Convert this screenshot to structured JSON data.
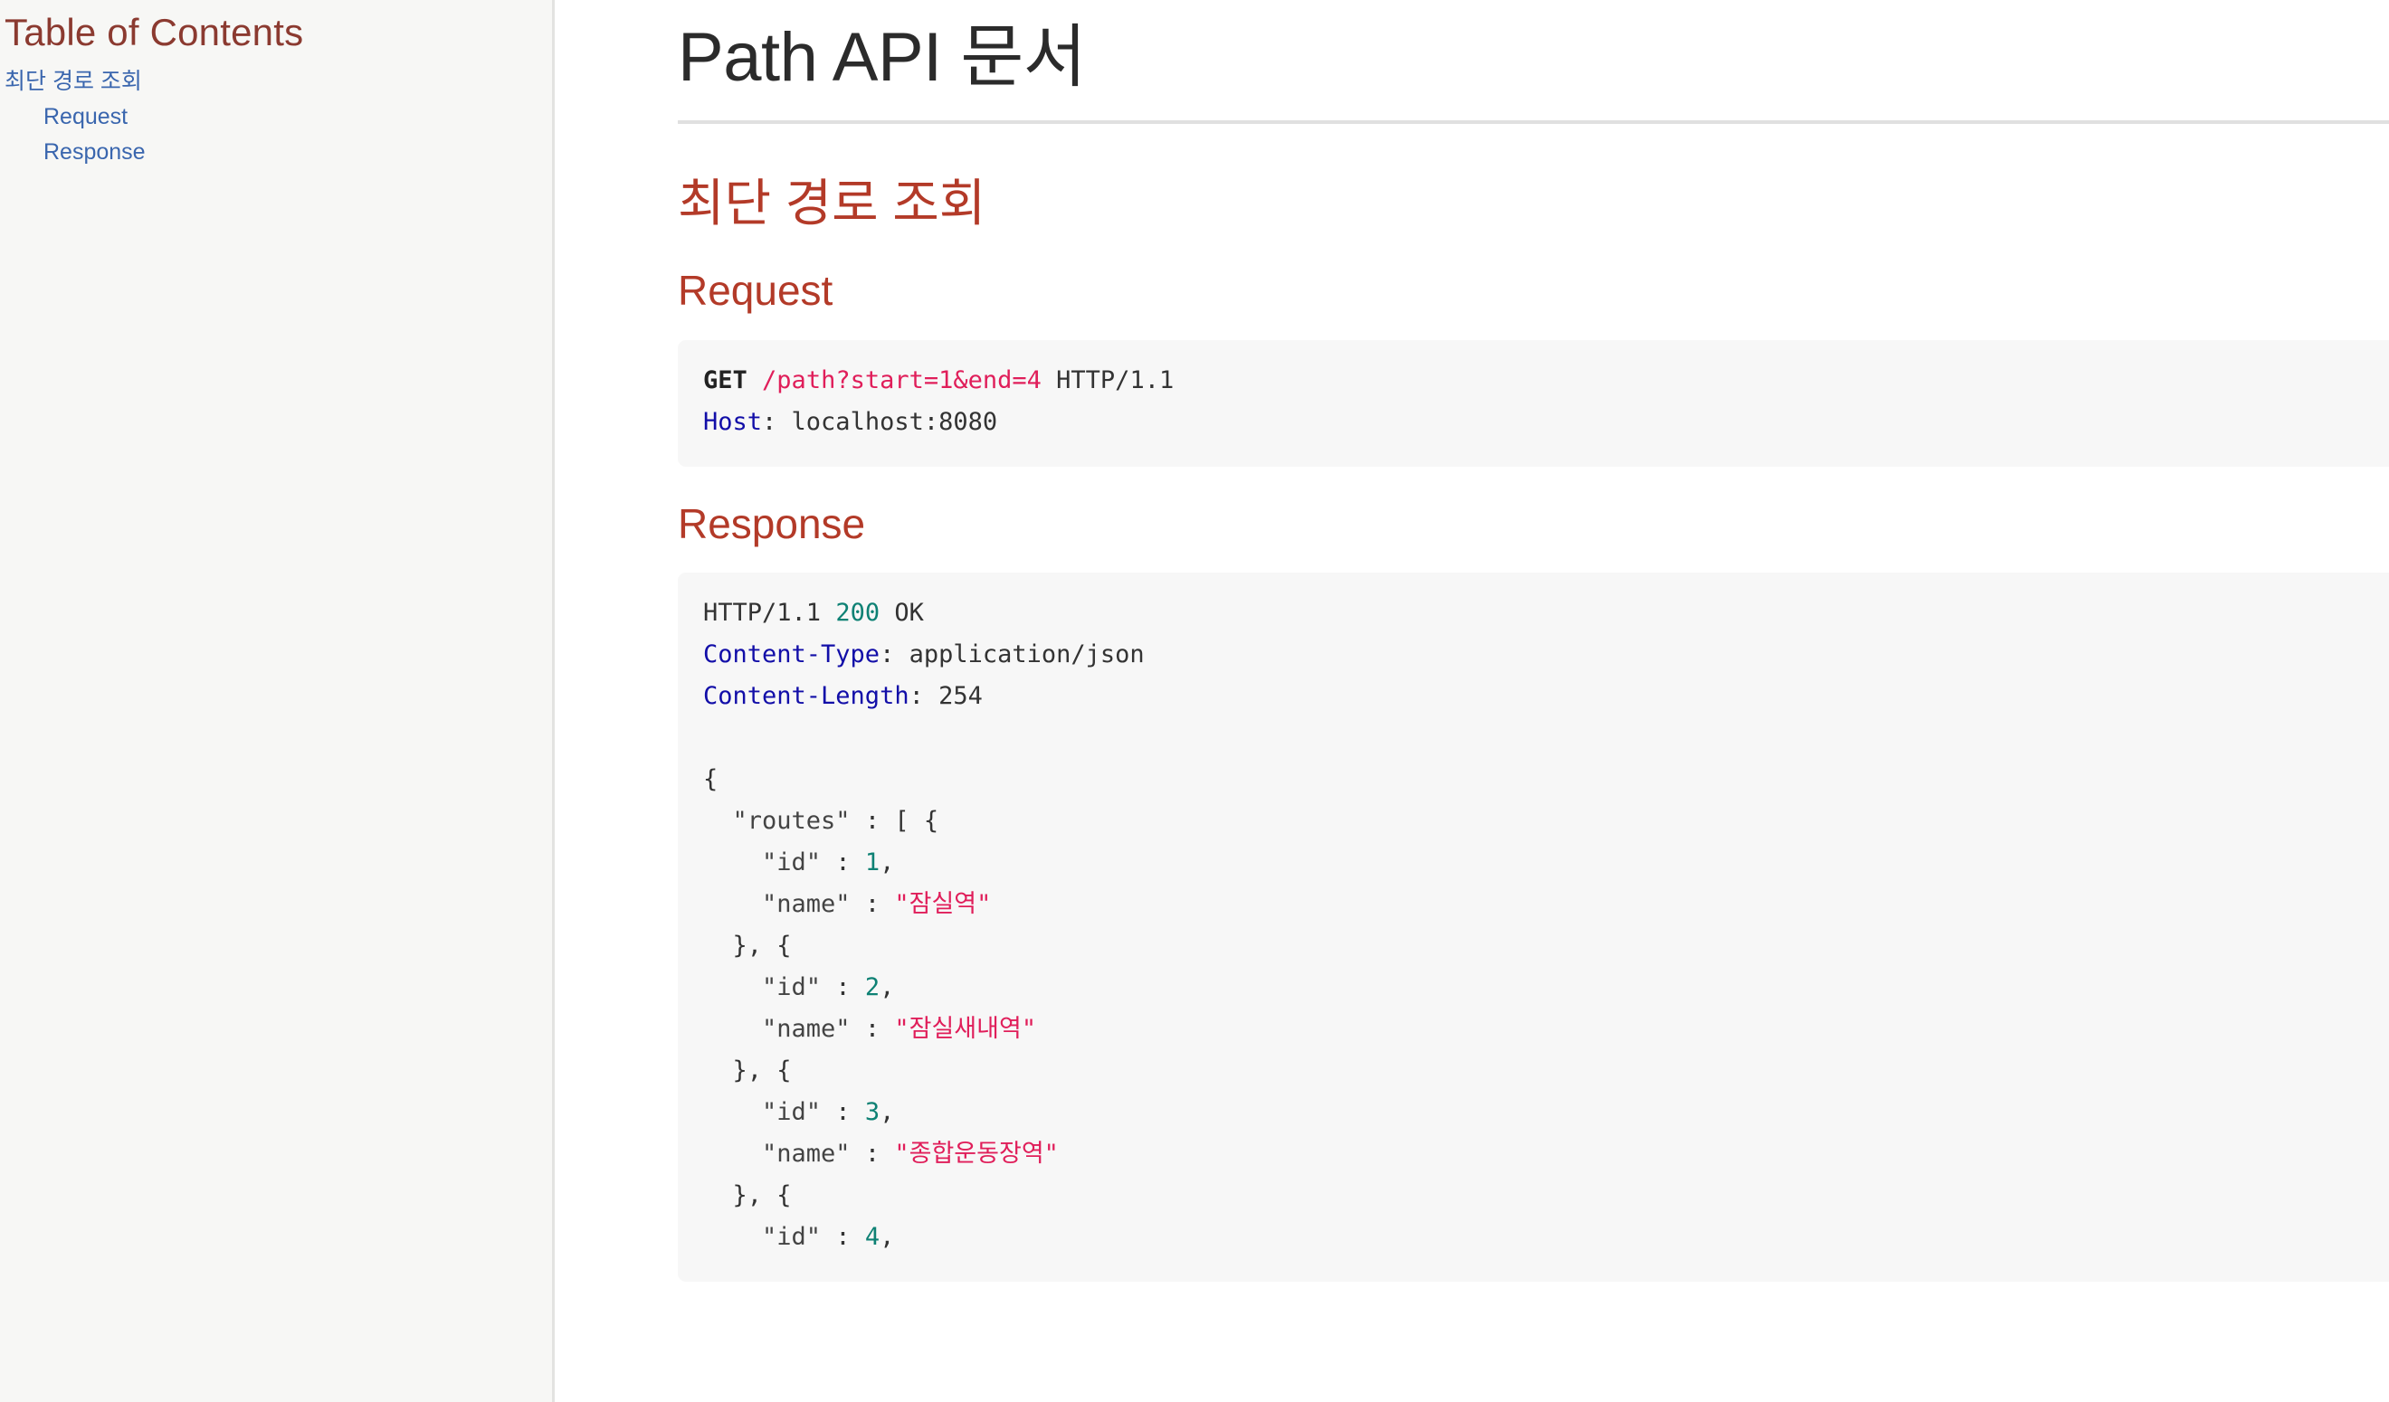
{
  "sidebar": {
    "title": "Table of Contents",
    "items": [
      {
        "label": "최단 경로 조회",
        "level": 1
      },
      {
        "label": "Request",
        "level": 2
      },
      {
        "label": "Response",
        "level": 2
      }
    ]
  },
  "main": {
    "doc_title": "Path API 문서",
    "section_heading": "최단 경로 조회",
    "request": {
      "heading": "Request",
      "lines": [
        [
          {
            "t": "GET",
            "c": "method"
          },
          {
            "t": " ",
            "c": "plain"
          },
          {
            "t": "/path?start=1&end=4",
            "c": "path"
          },
          {
            "t": " HTTP/1.1",
            "c": "plain"
          }
        ],
        [
          {
            "t": "Host",
            "c": "header"
          },
          {
            "t": ": localhost:8080",
            "c": "plain"
          }
        ]
      ]
    },
    "response": {
      "heading": "Response",
      "lines": [
        [
          {
            "t": "HTTP/1.1 ",
            "c": "plain"
          },
          {
            "t": "200",
            "c": "number"
          },
          {
            "t": " OK",
            "c": "plain"
          }
        ],
        [
          {
            "t": "Content-Type",
            "c": "header"
          },
          {
            "t": ": application/json",
            "c": "plain"
          }
        ],
        [
          {
            "t": "Content-Length",
            "c": "header"
          },
          {
            "t": ": 254",
            "c": "plain"
          }
        ],
        [
          {
            "t": "",
            "c": "plain"
          }
        ],
        [
          {
            "t": "{",
            "c": "punct"
          }
        ],
        [
          {
            "t": "  ",
            "c": "plain"
          },
          {
            "t": "\"routes\"",
            "c": "key"
          },
          {
            "t": " : [ {",
            "c": "punct"
          }
        ],
        [
          {
            "t": "    ",
            "c": "plain"
          },
          {
            "t": "\"id\"",
            "c": "key"
          },
          {
            "t": " : ",
            "c": "punct"
          },
          {
            "t": "1",
            "c": "number"
          },
          {
            "t": ",",
            "c": "punct"
          }
        ],
        [
          {
            "t": "    ",
            "c": "plain"
          },
          {
            "t": "\"name\"",
            "c": "key"
          },
          {
            "t": " : ",
            "c": "punct"
          },
          {
            "t": "\"잠실역\"",
            "c": "string"
          }
        ],
        [
          {
            "t": "  }, {",
            "c": "punct"
          }
        ],
        [
          {
            "t": "    ",
            "c": "plain"
          },
          {
            "t": "\"id\"",
            "c": "key"
          },
          {
            "t": " : ",
            "c": "punct"
          },
          {
            "t": "2",
            "c": "number"
          },
          {
            "t": ",",
            "c": "punct"
          }
        ],
        [
          {
            "t": "    ",
            "c": "plain"
          },
          {
            "t": "\"name\"",
            "c": "key"
          },
          {
            "t": " : ",
            "c": "punct"
          },
          {
            "t": "\"잠실새내역\"",
            "c": "string"
          }
        ],
        [
          {
            "t": "  }, {",
            "c": "punct"
          }
        ],
        [
          {
            "t": "    ",
            "c": "plain"
          },
          {
            "t": "\"id\"",
            "c": "key"
          },
          {
            "t": " : ",
            "c": "punct"
          },
          {
            "t": "3",
            "c": "number"
          },
          {
            "t": ",",
            "c": "punct"
          }
        ],
        [
          {
            "t": "    ",
            "c": "plain"
          },
          {
            "t": "\"name\"",
            "c": "key"
          },
          {
            "t": " : ",
            "c": "punct"
          },
          {
            "t": "\"종합운동장역\"",
            "c": "string"
          }
        ],
        [
          {
            "t": "  }, {",
            "c": "punct"
          }
        ],
        [
          {
            "t": "    ",
            "c": "plain"
          },
          {
            "t": "\"id\"",
            "c": "key"
          },
          {
            "t": " : ",
            "c": "punct"
          },
          {
            "t": "4",
            "c": "number"
          },
          {
            "t": ",",
            "c": "punct"
          }
        ]
      ]
    }
  },
  "colors": {
    "heading_red": "#b33a28",
    "toc_title_red": "#8b3a30",
    "link_blue": "#3a66ae",
    "code_bg": "#f7f7f7",
    "sidebar_bg": "#f7f7f5",
    "string_pink": "#e01e5a",
    "number_teal": "#0e8174",
    "header_navy": "#120ea8"
  }
}
